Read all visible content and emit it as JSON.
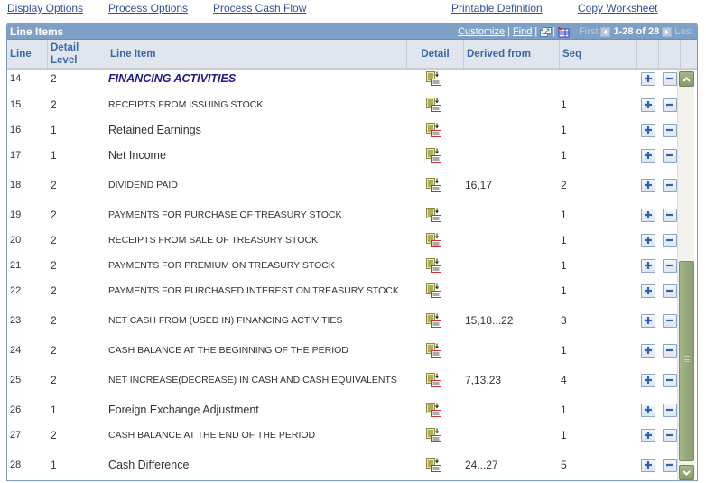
{
  "top_links": {
    "display_options": "Display Options",
    "process_options": "Process Options",
    "process_cash_flow": "Process Cash Flow",
    "printable_definition": "Printable Definition",
    "copy_worksheet": "Copy Worksheet"
  },
  "grid": {
    "title": "Line Items",
    "customize": "Customize",
    "find": "Find",
    "separator": "|",
    "first": "First",
    "range": "1-28 of 28",
    "last": "Last",
    "columns": {
      "line": "Line",
      "detail_level_1": "Detail",
      "detail_level_2": "Level",
      "line_item": "Line Item",
      "detail": "Detail",
      "derived_from": "Derived from",
      "seq": "Seq"
    },
    "rows": [
      {
        "line": "14",
        "level": "2",
        "item": "FINANCING ACTIVITIES",
        "style": "heading",
        "derived": "",
        "seq": ""
      },
      {
        "line": "15",
        "level": "2",
        "item": "RECEIPTS FROM ISSUING STOCK",
        "style": "upper",
        "derived": "",
        "seq": "1"
      },
      {
        "line": "16",
        "level": "1",
        "item": "Retained Earnings",
        "style": "mixed",
        "derived": "",
        "seq": "1"
      },
      {
        "line": "17",
        "level": "1",
        "item": "Net Income",
        "style": "mixed",
        "derived": "",
        "seq": "1"
      },
      {
        "line": "18",
        "level": "2",
        "item": "DIVIDEND PAID",
        "style": "upper",
        "derived": "16,17",
        "seq": "2"
      },
      {
        "line": "19",
        "level": "2",
        "item": "PAYMENTS FOR PURCHASE OF TREASURY STOCK",
        "style": "upper",
        "derived": "",
        "seq": "1"
      },
      {
        "line": "20",
        "level": "2",
        "item": "RECEIPTS FROM SALE OF TREASURY STOCK",
        "style": "upper",
        "derived": "",
        "seq": "1"
      },
      {
        "line": "21",
        "level": "2",
        "item": "PAYMENTS FOR PREMIUM ON TREASURY STOCK",
        "style": "upper",
        "derived": "",
        "seq": "1"
      },
      {
        "line": "22",
        "level": "2",
        "item": "PAYMENTS FOR PURCHASED INTEREST ON TREASURY STOCK",
        "style": "upper",
        "derived": "",
        "seq": "1"
      },
      {
        "line": "23",
        "level": "2",
        "item": "NET CASH FROM (USED IN) FINANCING ACTIVITIES",
        "style": "upper",
        "derived": "15,18...22",
        "seq": "3"
      },
      {
        "line": "24",
        "level": "2",
        "item": "CASH BALANCE AT THE BEGINNING OF THE PERIOD",
        "style": "upper",
        "derived": "",
        "seq": "1"
      },
      {
        "line": "25",
        "level": "2",
        "item": "NET INCREASE(DECREASE) IN CASH AND CASH EQUIVALENTS",
        "style": "upper",
        "derived": "7,13,23",
        "seq": "4"
      },
      {
        "line": "26",
        "level": "1",
        "item": "Foreign Exchange Adjustment",
        "style": "mixed",
        "derived": "",
        "seq": "1"
      },
      {
        "line": "27",
        "level": "2",
        "item": "CASH BALANCE AT THE END OF THE PERIOD",
        "style": "upper",
        "derived": "",
        "seq": "1"
      },
      {
        "line": "28",
        "level": "1",
        "item": "Cash Difference",
        "style": "mixed",
        "derived": "24...27",
        "seq": "5"
      }
    ]
  },
  "icons": {
    "detail": "detail-page-icon",
    "add": "plus-icon",
    "delete": "minus-icon",
    "zoom": "new-window-icon",
    "download": "download-to-excel-icon",
    "prev": "previous-arrow-icon",
    "next": "next-arrow-icon"
  },
  "colors": {
    "link": "#31519a",
    "title_bar": "#7ea0c6",
    "header_bg": "#e1e6ee",
    "header_text": "#3a68a6",
    "heading_item": "#1c1c8c",
    "scrollbar": "#94a978"
  }
}
